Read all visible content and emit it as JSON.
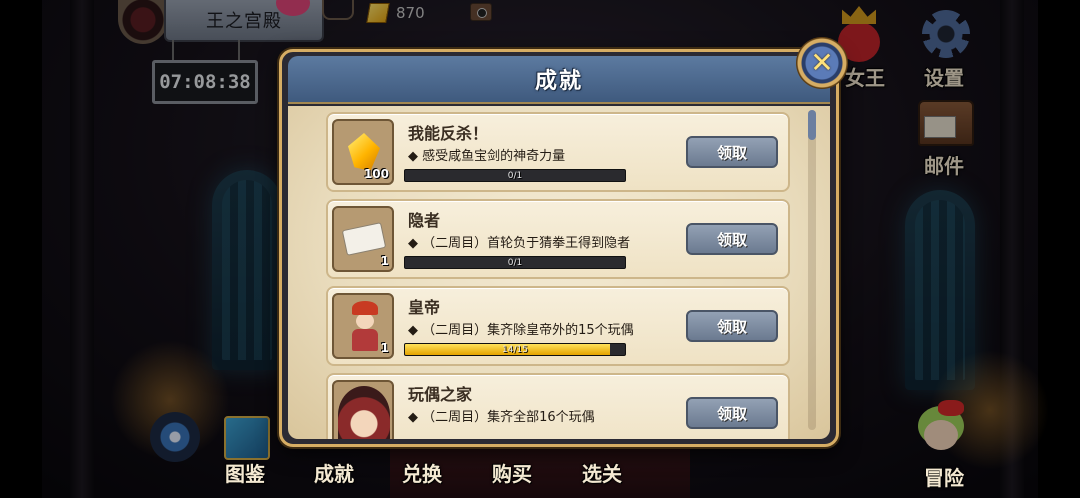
{
  "hud": {
    "location": "王之宫殿",
    "timer": "07:08:38",
    "currency": "870",
    "right_menu": {
      "queen": "女王",
      "settings": "设置",
      "mail": "邮件"
    },
    "bottom_menu": {
      "encyclopedia": "图鉴",
      "achievement": "成就",
      "exchange": "兑换",
      "shop": "购买",
      "stage_select": "选关",
      "adventure": "冒险"
    }
  },
  "modal": {
    "title": "成就",
    "achievements": [
      {
        "title": "我能反杀！",
        "desc": "◆ 感受咸鱼宝剑的神奇力量",
        "progress": "0/1",
        "fraction": 0,
        "count": "100",
        "claim": "领取",
        "icon": "gold-gem-icon"
      },
      {
        "title": "隐者",
        "desc": "◆ （二周目）首轮负于猜拳王得到隐者",
        "progress": "0/1",
        "fraction": 0,
        "count": "1",
        "claim": "领取",
        "icon": "ticket-icon"
      },
      {
        "title": "皇帝",
        "desc": "◆ （二周目）集齐除皇帝外的15个玩偶",
        "progress": "14/15",
        "fraction": 0.933,
        "count": "1",
        "claim": "领取",
        "icon": "emperor-doll-icon"
      },
      {
        "title": "玩偶之家",
        "desc": "◆ （二周目）集齐全部16个玩偶",
        "progress": "",
        "fraction": 0,
        "count": "",
        "claim": "领取",
        "icon": "doll-portrait-icon"
      }
    ]
  },
  "colors": {
    "progress_fill": "#f2c200",
    "header": "#4f6b92",
    "frame_gold": "#d6ad64"
  }
}
